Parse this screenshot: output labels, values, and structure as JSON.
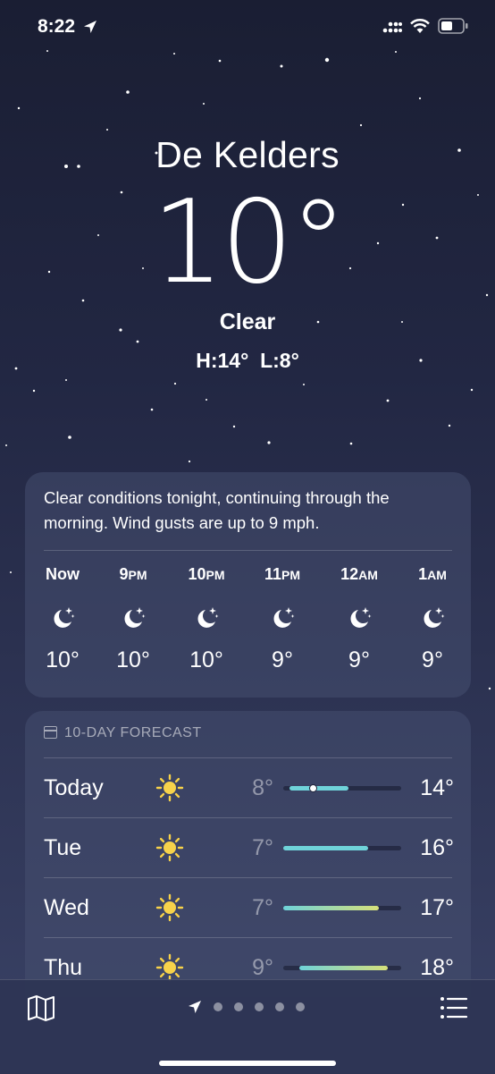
{
  "status_bar": {
    "time": "8:22",
    "icons": [
      "location-arrow-icon",
      "cellular-signal-icon",
      "wifi-icon",
      "battery-icon"
    ]
  },
  "location": {
    "city": "De Kelders",
    "temperature": "10°",
    "condition": "Clear",
    "high_low": "H:14°  L:8°"
  },
  "hourly": {
    "summary": "Clear conditions tonight, continuing through the morning. Wind gusts are up to 9 mph.",
    "hours": [
      {
        "label": "Now",
        "suffix": "",
        "icon": "moon-stars-icon",
        "temp": "10°"
      },
      {
        "label": "9",
        "suffix": "PM",
        "icon": "moon-stars-icon",
        "temp": "10°"
      },
      {
        "label": "10",
        "suffix": "PM",
        "icon": "moon-stars-icon",
        "temp": "10°"
      },
      {
        "label": "11",
        "suffix": "PM",
        "icon": "moon-stars-icon",
        "temp": "9°"
      },
      {
        "label": "12",
        "suffix": "AM",
        "icon": "moon-stars-icon",
        "temp": "9°"
      },
      {
        "label": "1",
        "suffix": "AM",
        "icon": "moon-stars-icon",
        "temp": "9°"
      }
    ]
  },
  "daily": {
    "header": "10-DAY FORECAST",
    "header_icon": "calendar-icon",
    "days": [
      {
        "day": "Today",
        "icon": "sun-icon",
        "low": "8°",
        "high": "14°",
        "range_start": 0.05,
        "range_end": 0.55,
        "current": 0.25
      },
      {
        "day": "Tue",
        "icon": "sun-icon",
        "low": "7°",
        "high": "16°",
        "range_start": 0.0,
        "range_end": 0.72
      },
      {
        "day": "Wed",
        "icon": "sun-icon",
        "low": "7°",
        "high": "17°",
        "range_start": 0.0,
        "range_end": 0.81
      },
      {
        "day": "Thu",
        "icon": "sun-icon",
        "low": "9°",
        "high": "18°",
        "range_start": 0.14,
        "range_end": 0.89
      }
    ]
  },
  "bottom_bar": {
    "icons": [
      "map-icon",
      "location-arrow-icon",
      "list-icon"
    ],
    "page_count": 5
  },
  "colors": {
    "sun": "#f7d24a",
    "bar_start": "#6fd3d9",
    "bar_end": "#d6e07a"
  }
}
